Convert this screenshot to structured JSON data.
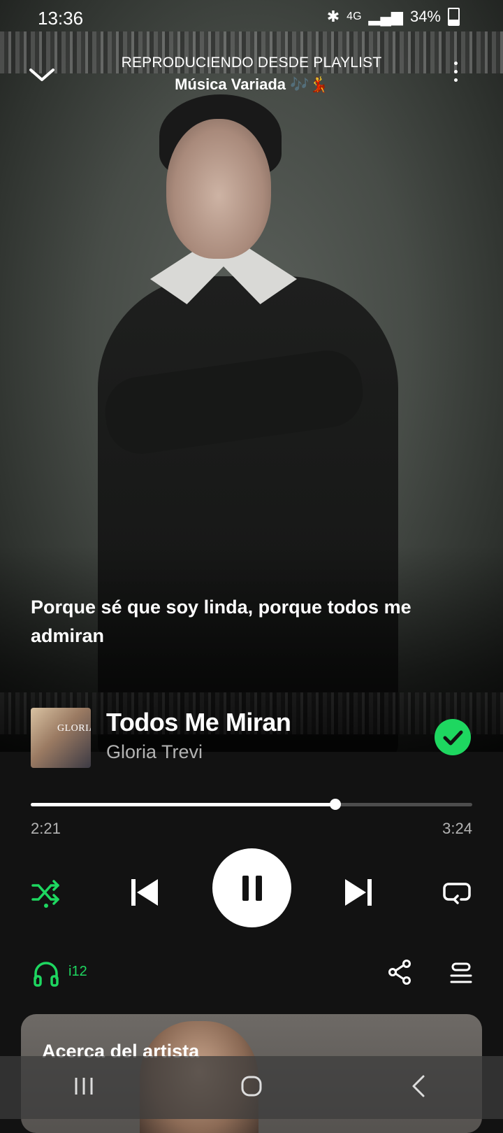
{
  "status_bar": {
    "time": "13:36",
    "network": "4G",
    "battery": "34%"
  },
  "header": {
    "context_label": "REPRODUCIENDO DESDE PLAYLIST",
    "playlist_name": "Música Variada 🎶💃"
  },
  "lyrics": {
    "current_line": "Porque sé que soy linda, porque todos me admiran"
  },
  "track": {
    "title": "Todos Me Miran",
    "artist": "Gloria Trevi",
    "cover_text": "GLORIA",
    "liked": true
  },
  "progress": {
    "elapsed": "2:21",
    "duration": "3:24",
    "fraction": 0.69
  },
  "controls": {
    "shuffle_active": true,
    "state": "playing"
  },
  "device": {
    "label": "i12"
  },
  "about_artist": {
    "title": "Acerca del artista"
  },
  "colors": {
    "accent": "#1ed760",
    "background": "#121212",
    "secondary_text": "#b3b3b3"
  }
}
